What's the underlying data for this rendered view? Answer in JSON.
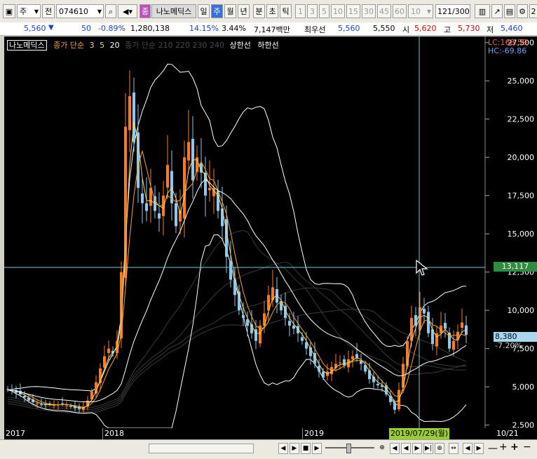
{
  "toolbar": {
    "market": "주",
    "type": "전",
    "code": "074610",
    "pill": "종",
    "stock_name": "나노메딕스",
    "periods": [
      "일",
      "주",
      "월",
      "년"
    ],
    "selected_period": "주",
    "intervals": [
      "분",
      "초",
      "틱"
    ],
    "minutes": [
      "1",
      "3",
      "5",
      "10",
      "15",
      "30",
      "45",
      "60"
    ],
    "count_select": "10",
    "counter": "121",
    "counter_total": "/300",
    "right_num": "2"
  },
  "quote": {
    "price": "5,560",
    "arrow": "▼",
    "change": "50",
    "change_pct": "-0.89%",
    "volume": "1,280,138",
    "vol_pct": "14.15%",
    "turnover": "3.44%",
    "amount": "7,147백만",
    "bid_label": "최우선",
    "ask1": "5,560",
    "bid1": "5,550",
    "open_label": "시",
    "open": "5,620",
    "high_label": "고",
    "high": "5,730",
    "low_label": "저",
    "low": "5,460"
  },
  "chart_legend": {
    "name": "나노메딕스",
    "ma_label": "종가 단순",
    "ma_periods": [
      "3",
      "5",
      "20"
    ],
    "faint": "종가 단순 210 220 230 240",
    "upper": "상한선",
    "lower": "하한선"
  },
  "right_info": {
    "lc": "LC:168.59",
    "hc": "HC:-69.86",
    "crosshair_price": "13,117",
    "last_price": "8,380",
    "last_pct": "-7.20%"
  },
  "x_axis": {
    "labels": [
      "2017",
      "2018",
      "2019",
      "10/21"
    ],
    "crosshair_date": "2019/07/29(월)"
  },
  "chart_data": {
    "type": "candlestick",
    "title": "나노메딕스",
    "y_ticks": [
      2500,
      5000,
      7500,
      10000,
      12500,
      15000,
      17500,
      20000,
      22500,
      25000,
      27500
    ],
    "ylim": [
      2300,
      27900
    ],
    "x_labels": [
      "2017",
      "2018",
      "2019"
    ],
    "closes": [
      4800,
      4750,
      4600,
      4500,
      4300,
      4100,
      4000,
      3900,
      3850,
      3800,
      3850,
      3800,
      3850,
      3900,
      3800,
      3700,
      3600,
      3550,
      3700,
      4100,
      4700,
      5300,
      6200,
      7000,
      7500,
      7200,
      8000,
      12500,
      22000,
      24000,
      21000,
      18000,
      17000,
      16500,
      18000,
      16500,
      16000,
      17500,
      19500,
      17000,
      15500,
      16500,
      20000,
      21000,
      18500,
      20000,
      19000,
      17500,
      18000,
      18000,
      16500,
      15500,
      13500,
      12000,
      11000,
      10000,
      9500,
      9000,
      8500,
      8000,
      9000,
      9800,
      11000,
      11500,
      10500,
      10000,
      9500,
      9000,
      8800,
      8500,
      8000,
      7500,
      7000,
      6500,
      6000,
      5600,
      6000,
      6300,
      6500,
      6600,
      6400,
      6800,
      7000,
      6900,
      6500,
      6000,
      5500,
      5300,
      5100,
      5000,
      4500,
      4000,
      3500,
      4800,
      6500,
      8000,
      9500,
      9000,
      10200,
      9800,
      8500,
      7800,
      8500,
      9000,
      8800,
      7500,
      8000,
      8600,
      9200,
      8400
    ]
  }
}
